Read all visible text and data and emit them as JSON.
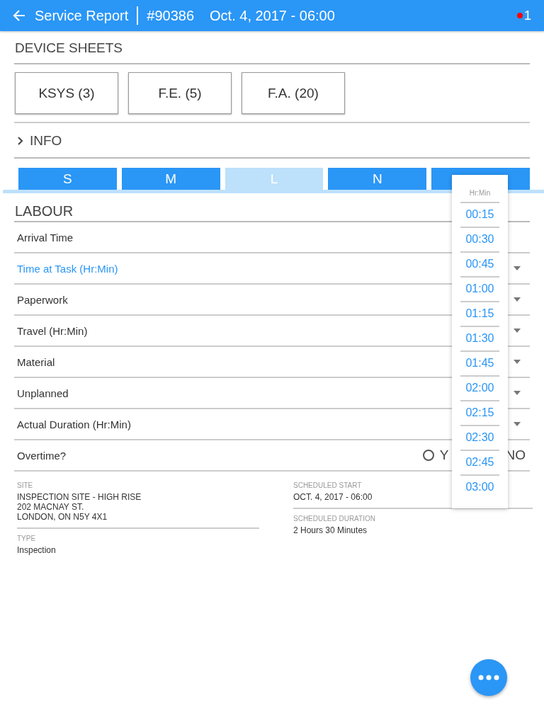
{
  "header": {
    "title": "Service Report",
    "number": "#90386",
    "date": "Oct. 4, 2017 - 06:00",
    "notification_count": "1"
  },
  "device_sheets": {
    "title": "DEVICE SHEETS",
    "buttons": [
      "KSYS (3)",
      "F.E. (5)",
      "F.A. (20)"
    ]
  },
  "info": {
    "label": "INFO",
    "expanded": false
  },
  "tabs": [
    {
      "label": "S",
      "selected": false
    },
    {
      "label": "M",
      "selected": false
    },
    {
      "label": "L",
      "selected": true
    },
    {
      "label": "N",
      "selected": false
    },
    {
      "selected": false
    }
  ],
  "labour": {
    "title": "LABOUR",
    "rows": [
      {
        "label": "Arrival Time",
        "kind": "time",
        "focused": false
      },
      {
        "label": "Time at Task (Hr:Min)",
        "kind": "select",
        "focused": true
      },
      {
        "label": "Paperwork",
        "kind": "select",
        "focused": false
      },
      {
        "label": "Travel (Hr:Min)",
        "kind": "select",
        "focused": false
      },
      {
        "label": "Material",
        "kind": "select",
        "focused": false
      },
      {
        "label": "Unplanned",
        "kind": "select",
        "focused": false
      },
      {
        "label": "Actual Duration (Hr:Min)",
        "kind": "select",
        "focused": false
      }
    ],
    "overtime": {
      "label": "Overtime?",
      "options": [
        {
          "label": "Y",
          "selected": false
        },
        {
          "label": "NO"
        }
      ]
    }
  },
  "details": {
    "left": [
      {
        "label": "SITE",
        "lines": [
          "INSPECTION SITE - HIGH RISE",
          "202 MACNAY ST.",
          "LONDON, ON N5Y 4X1"
        ]
      },
      {
        "label": "TYPE",
        "lines": [
          "Inspection"
        ]
      }
    ],
    "right": [
      {
        "label": "SCHEDULED START",
        "lines": [
          "OCT. 4, 2017 - 06:00"
        ]
      },
      {
        "label": "SCHEDULED DURATION",
        "lines": [
          "2 Hours 30 Minutes"
        ]
      }
    ]
  },
  "picker": {
    "title": "Hr:Min",
    "options": [
      "00:15",
      "00:30",
      "00:45",
      "01:00",
      "01:15",
      "01:30",
      "01:45",
      "02:00",
      "02:15",
      "02:30",
      "02:45",
      "03:00"
    ]
  }
}
